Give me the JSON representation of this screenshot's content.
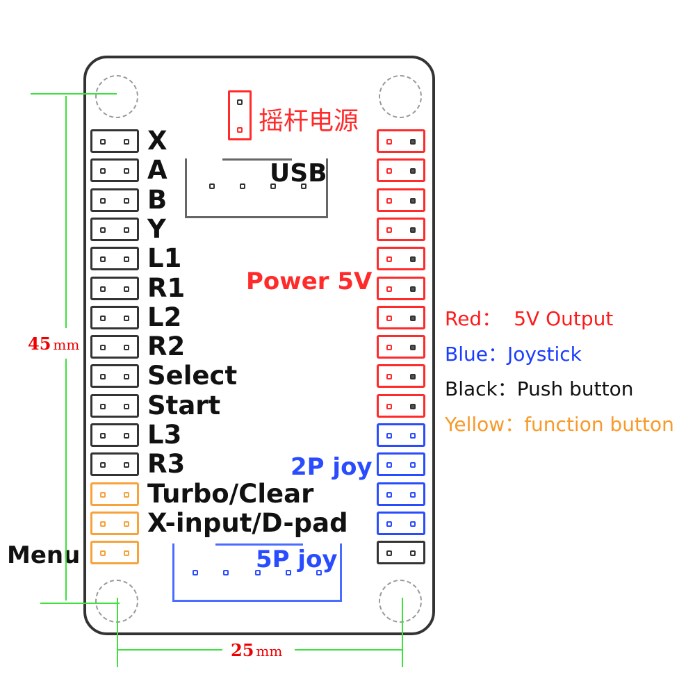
{
  "board": {
    "power_header_label": "摇杆电源",
    "usb_label": "USB",
    "power_5v_label": "Power 5V",
    "joy_2p_label": "2P joy",
    "joy_5p_label": "5P joy",
    "menu_label": "Menu"
  },
  "left_headers": [
    {
      "label": "X",
      "color": "black"
    },
    {
      "label": "A",
      "color": "black"
    },
    {
      "label": "B",
      "color": "black"
    },
    {
      "label": "Y",
      "color": "black"
    },
    {
      "label": "L1",
      "color": "black"
    },
    {
      "label": "R1",
      "color": "black"
    },
    {
      "label": "L2",
      "color": "black"
    },
    {
      "label": "R2",
      "color": "black"
    },
    {
      "label": "Select",
      "color": "black"
    },
    {
      "label": "Start",
      "color": "black"
    },
    {
      "label": "L3",
      "color": "black"
    },
    {
      "label": "R3",
      "color": "black"
    },
    {
      "label": "Turbo/Clear",
      "color": "orange"
    },
    {
      "label": "X-input/D-pad",
      "color": "orange"
    },
    {
      "label": "",
      "color": "orange"
    }
  ],
  "right_headers": [
    "red",
    "red",
    "red",
    "red",
    "red",
    "red",
    "red",
    "red",
    "red",
    "red",
    "blue",
    "blue",
    "blue",
    "blue",
    "black"
  ],
  "legend": [
    {
      "key": "Red：",
      "value": "5V Output",
      "color": "#ff1a1a"
    },
    {
      "key": "Blue：",
      "value": "Joystick",
      "color": "#1a3cff"
    },
    {
      "key": "Black：",
      "value": "Push button",
      "color": "#111111"
    },
    {
      "key": "Yellow：",
      "value": "function button",
      "color": "#f79a2a"
    }
  ],
  "dimensions": {
    "height_value": "45",
    "width_value": "25",
    "unit": "mm"
  },
  "colors": {
    "red": "#ff2a2a",
    "blue": "#2a4cff",
    "orange": "#f7a23a",
    "black": "#333333",
    "dimension_line": "#3ee03e",
    "dimension_text": "#e00000"
  }
}
